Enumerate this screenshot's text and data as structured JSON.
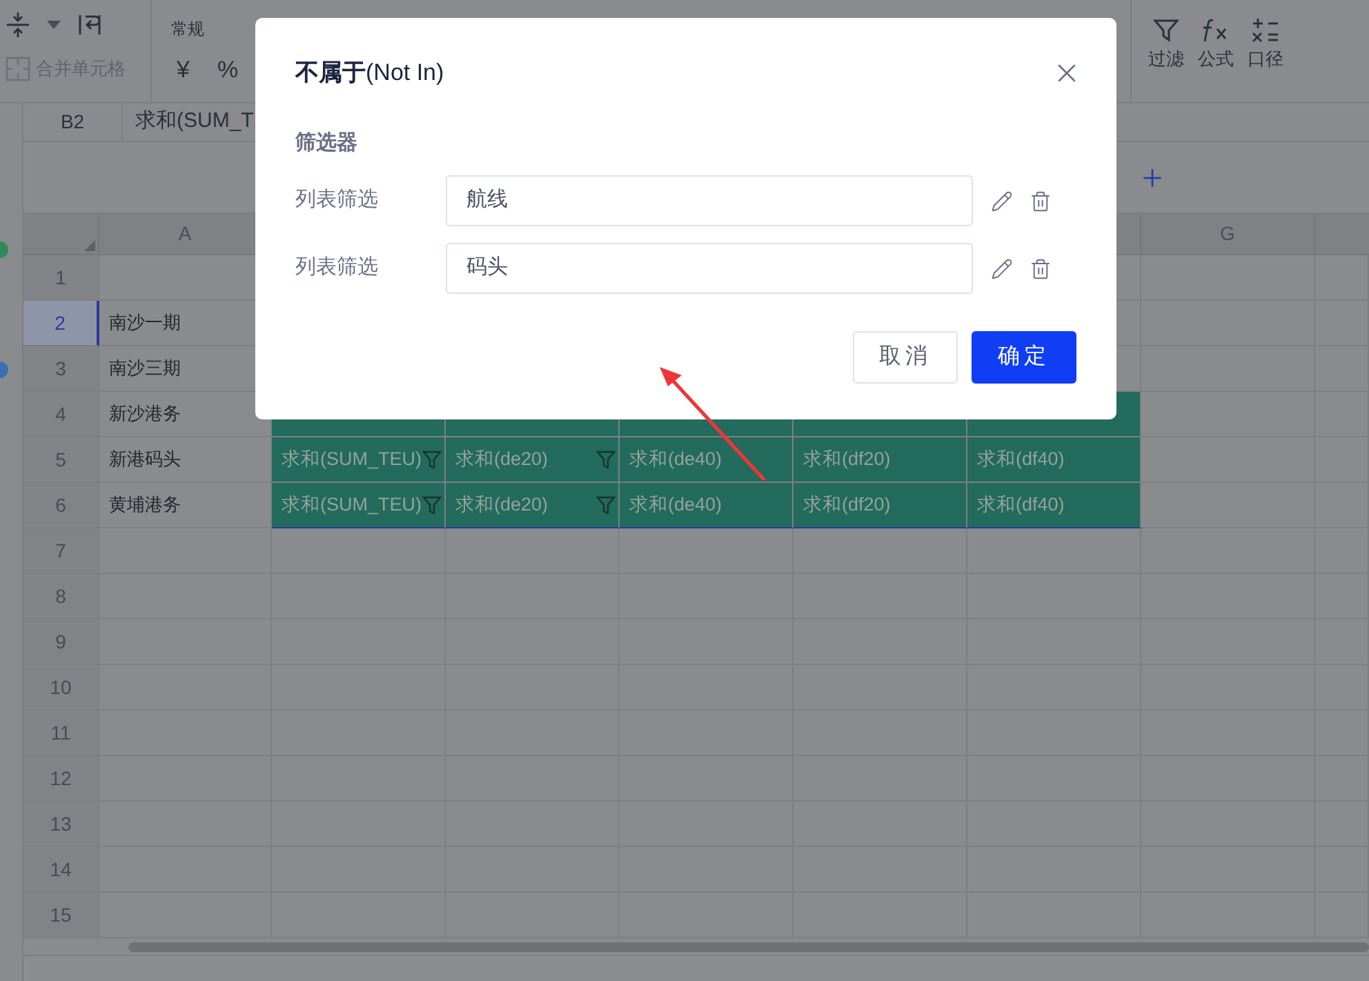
{
  "toolbar": {
    "merge_label": "合并单元格",
    "format_label": "常规",
    "currency": "¥",
    "percent": "%",
    "right_tools": [
      {
        "kind": "filter",
        "label": "过滤"
      },
      {
        "kind": "formula",
        "label": "公式"
      },
      {
        "kind": "caliber",
        "label": "口径"
      }
    ]
  },
  "formula_bar": {
    "cell": "B2",
    "formula": "求和(SUM_T"
  },
  "sheet": {
    "column_headers": {
      "first": "A",
      "last": "G"
    },
    "rows": [
      {
        "number": "1",
        "selected": false
      },
      {
        "number": "2",
        "selected": true,
        "name": "南沙一期"
      },
      {
        "number": "3",
        "selected": false,
        "name": "南沙三期"
      },
      {
        "number": "4",
        "selected": false,
        "in_range": true,
        "name": "新沙港务"
      },
      {
        "number": "5",
        "selected": false,
        "in_range": true,
        "name": "新港码头",
        "values": [
          {
            "text": "求和(SUM_TEU)",
            "filter": true
          },
          {
            "text": "求和(de20)",
            "filter": true
          },
          {
            "text": "求和(de40)",
            "filter": false
          },
          {
            "text": "求和(df20)",
            "filter": false
          },
          {
            "text": "求和(df40)",
            "filter": false
          }
        ]
      },
      {
        "number": "6",
        "selected": false,
        "in_range": true,
        "name": "黄埔港务",
        "values": [
          {
            "text": "求和(SUM_TEU)",
            "filter": true
          },
          {
            "text": "求和(de20)",
            "filter": true
          },
          {
            "text": "求和(de40)",
            "filter": false
          },
          {
            "text": "求和(df20)",
            "filter": false
          },
          {
            "text": "求和(df40)",
            "filter": false
          }
        ]
      },
      {
        "number": "7",
        "selected": false,
        "in_range": false
      },
      {
        "number": "8",
        "selected": false,
        "in_range": false
      },
      {
        "number": "9",
        "selected": false,
        "in_range": false
      },
      {
        "number": "10",
        "selected": false,
        "in_range": false
      },
      {
        "number": "11",
        "selected": false,
        "in_range": false
      },
      {
        "number": "12",
        "selected": false,
        "in_range": false
      },
      {
        "number": "13",
        "selected": false,
        "in_range": false
      },
      {
        "number": "14",
        "selected": false,
        "in_range": false
      },
      {
        "number": "15",
        "selected": false,
        "in_range": false
      }
    ]
  },
  "dialog": {
    "title": "**不属于**(Not In)",
    "section": "筛选器",
    "filters": [
      {
        "label": "列表筛选",
        "value": "航线"
      },
      {
        "label": "列表筛选",
        "value": "码头"
      }
    ],
    "buttons": [
      {
        "kind": "secondary",
        "label": "取消"
      },
      {
        "kind": "primary",
        "label": "确定"
      }
    ]
  }
}
